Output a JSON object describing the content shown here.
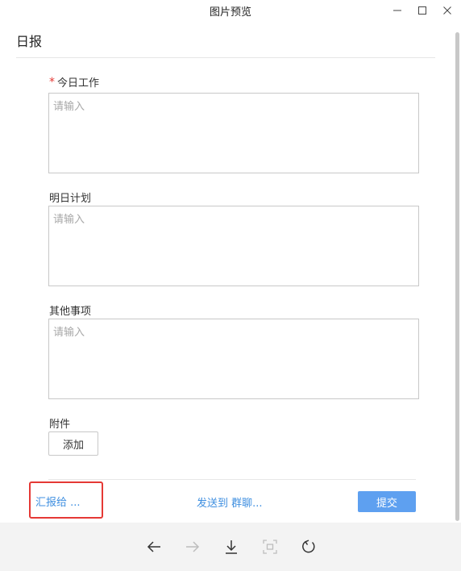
{
  "window": {
    "title": "图片预览"
  },
  "form": {
    "heading": "日报",
    "required_mark": "*",
    "fields": [
      {
        "label": "今日工作",
        "placeholder": "请输入"
      },
      {
        "label": "明日计划",
        "placeholder": "请输入"
      },
      {
        "label": "其他事项",
        "placeholder": "请输入"
      }
    ],
    "attachment_label": "附件",
    "add_button": "添加"
  },
  "footer": {
    "report_to": "汇报给 ...",
    "send_to_group": "发送到 群聊...",
    "submit": "提交"
  },
  "toolbar": {
    "icons": [
      "arrow-left-icon",
      "arrow-right-icon",
      "download-icon",
      "fit-screen-icon",
      "rotate-icon"
    ]
  },
  "colors": {
    "accent_link": "#3f8fe0",
    "submit_bg": "#5ea0f0",
    "required": "#e53935",
    "highlight_box": "#e53935",
    "toolbar_bg": "#f3f3f3"
  }
}
